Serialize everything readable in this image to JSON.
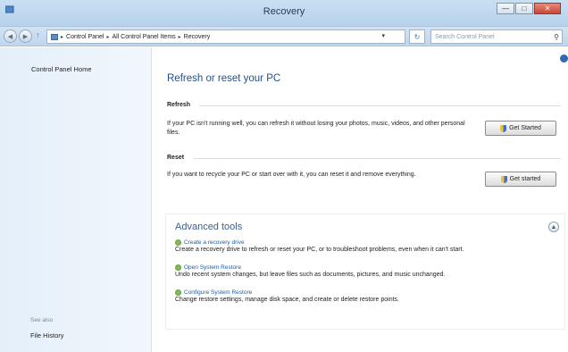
{
  "window": {
    "title": "Recovery"
  },
  "nav": {
    "breadcrumb": [
      "Control Panel",
      "All Control Panel Items",
      "Recovery"
    ],
    "search_placeholder": "Search Control Panel"
  },
  "sidebar": {
    "home_link": "Control Panel Home",
    "see_also_label": "See also",
    "see_also_links": [
      "File History"
    ]
  },
  "main": {
    "heading": "Refresh or reset your PC",
    "refresh": {
      "title": "Refresh",
      "description": "If your PC isn't running well, you can refresh it without losing your photos, music, videos, and other personal files.",
      "button_label": "Get Started"
    },
    "reset": {
      "title": "Reset",
      "description": "If you want to recycle your PC or start over with it, you can reset it and remove everything.",
      "button_label": "Get started"
    },
    "advanced": {
      "title": "Advanced tools",
      "tools": [
        {
          "link": "Create a recovery drive",
          "description": "Create a recovery drive to refresh or reset your PC, or to troubleshoot problems, even when it can't start."
        },
        {
          "link": "Open System Restore",
          "description": "Undo recent system changes, but leave files such as documents, pictures, and music unchanged."
        },
        {
          "link": "Configure System Restore",
          "description": "Change restore settings, manage disk space, and create or delete restore points."
        }
      ]
    }
  }
}
